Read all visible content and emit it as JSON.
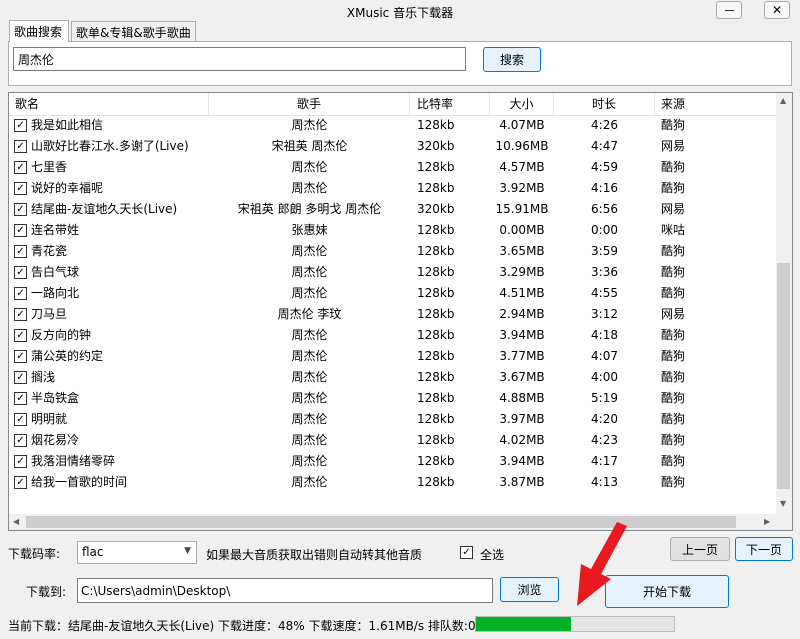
{
  "window": {
    "title": "XMusic 音乐下载器"
  },
  "tabs": [
    {
      "label": "歌曲搜索",
      "active": true
    },
    {
      "label": "歌单&专辑&歌手歌曲",
      "active": false
    }
  ],
  "search": {
    "value": "周杰伦",
    "button": "搜索"
  },
  "table": {
    "columns": [
      "歌名",
      "歌手",
      "比特率",
      "大小",
      "时长",
      "来源"
    ],
    "rows": [
      {
        "checked": true,
        "title": "我是如此相信",
        "artist": "周杰伦",
        "bitrate": "128kb",
        "size": "4.07MB",
        "duration": "4:26",
        "source": "酷狗"
      },
      {
        "checked": true,
        "title": "山歌好比春江水.多谢了(Live)",
        "artist": "宋祖英 周杰伦",
        "bitrate": "320kb",
        "size": "10.96MB",
        "duration": "4:47",
        "source": "网易"
      },
      {
        "checked": true,
        "title": "七里香",
        "artist": "周杰伦",
        "bitrate": "128kb",
        "size": "4.57MB",
        "duration": "4:59",
        "source": "酷狗"
      },
      {
        "checked": true,
        "title": "说好的幸福呢",
        "artist": "周杰伦",
        "bitrate": "128kb",
        "size": "3.92MB",
        "duration": "4:16",
        "source": "酷狗"
      },
      {
        "checked": true,
        "title": "结尾曲-友谊地久天长(Live)",
        "artist": "宋祖英 郎朗 多明戈 周杰伦",
        "bitrate": "320kb",
        "size": "15.91MB",
        "duration": "6:56",
        "source": "网易"
      },
      {
        "checked": true,
        "title": "连名带姓",
        "artist": "张惠妹",
        "bitrate": "128kb",
        "size": "0.00MB",
        "duration": "0:00",
        "source": "咪咕"
      },
      {
        "checked": true,
        "title": "青花瓷",
        "artist": "周杰伦",
        "bitrate": "128kb",
        "size": "3.65MB",
        "duration": "3:59",
        "source": "酷狗"
      },
      {
        "checked": true,
        "title": "告白气球",
        "artist": "周杰伦",
        "bitrate": "128kb",
        "size": "3.29MB",
        "duration": "3:36",
        "source": "酷狗"
      },
      {
        "checked": true,
        "title": "一路向北",
        "artist": "周杰伦",
        "bitrate": "128kb",
        "size": "4.51MB",
        "duration": "4:55",
        "source": "酷狗"
      },
      {
        "checked": true,
        "title": "刀马旦",
        "artist": "周杰伦 李玟",
        "bitrate": "128kb",
        "size": "2.94MB",
        "duration": "3:12",
        "source": "网易"
      },
      {
        "checked": true,
        "title": "反方向的钟",
        "artist": "周杰伦",
        "bitrate": "128kb",
        "size": "3.94MB",
        "duration": "4:18",
        "source": "酷狗"
      },
      {
        "checked": true,
        "title": "蒲公英的约定",
        "artist": "周杰伦",
        "bitrate": "128kb",
        "size": "3.77MB",
        "duration": "4:07",
        "source": "酷狗"
      },
      {
        "checked": true,
        "title": "搁浅",
        "artist": "周杰伦",
        "bitrate": "128kb",
        "size": "3.67MB",
        "duration": "4:00",
        "source": "酷狗"
      },
      {
        "checked": true,
        "title": "半岛铁盒",
        "artist": "周杰伦",
        "bitrate": "128kb",
        "size": "4.88MB",
        "duration": "5:19",
        "source": "酷狗"
      },
      {
        "checked": true,
        "title": "明明就",
        "artist": "周杰伦",
        "bitrate": "128kb",
        "size": "3.97MB",
        "duration": "4:20",
        "source": "酷狗"
      },
      {
        "checked": true,
        "title": "烟花易冷",
        "artist": "周杰伦",
        "bitrate": "128kb",
        "size": "4.02MB",
        "duration": "4:23",
        "source": "酷狗"
      },
      {
        "checked": true,
        "title": "我落泪情绪零碎",
        "artist": "周杰伦",
        "bitrate": "128kb",
        "size": "3.94MB",
        "duration": "4:17",
        "source": "酷狗"
      },
      {
        "checked": true,
        "title": "给我一首歌的时间",
        "artist": "周杰伦",
        "bitrate": "128kb",
        "size": "3.87MB",
        "duration": "4:13",
        "source": "酷狗"
      }
    ]
  },
  "download": {
    "bitrate_label": "下载码率:",
    "bitrate_value": "flac",
    "fallback_note": "如果最大音质获取出错则自动转其他音质",
    "select_all_label": "全选",
    "select_all_checked": true,
    "prev_page": "上一页",
    "next_page": "下一页",
    "path_label": "下载到:",
    "path_value": "C:\\Users\\admin\\Desktop\\",
    "browse": "浏览",
    "start": "开始下载"
  },
  "status": {
    "text": "当前下载：结尾曲-友谊地久天长(Live) 下载进度：48% 下载速度：1.61MB/s 排队数:0",
    "progress_fraction": 0.48
  },
  "colors": {
    "progress": "#06b025",
    "accent": "#0078d7",
    "arrow": "#e8191f"
  },
  "icons": [
    "minimize-icon",
    "close-icon",
    "checkbox-checked-icon",
    "chevron-down-icon",
    "scroll-arrow-icon",
    "red-arrow-icon"
  ]
}
